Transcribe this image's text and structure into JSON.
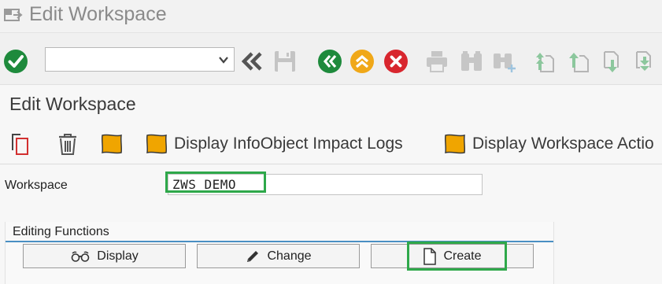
{
  "window": {
    "title": "Edit Workspace"
  },
  "toolbar": {
    "command_field": {
      "value": "",
      "placeholder": ""
    },
    "icons": [
      "enter-icon",
      "dropdown-icon",
      "back-nav-icon",
      "save-icon",
      "back-icon",
      "exit-icon",
      "cancel-icon",
      "print-icon",
      "find-icon",
      "find-next-icon",
      "first-page-icon",
      "previous-page-icon",
      "next-page-icon",
      "last-page-icon"
    ]
  },
  "screen": {
    "title": "Edit Workspace"
  },
  "app_toolbar": {
    "impact_logs_label": "Display InfoObject Impact Logs",
    "workspace_actions_label": "Display Workspace Actio"
  },
  "workspace": {
    "label": "Workspace",
    "value": "ZWS_DEMO"
  },
  "editing": {
    "group_title": "Editing Functions",
    "display_label": "Display",
    "change_label": "Change",
    "create_label": "Create"
  },
  "colors": {
    "enter_green": "#1e8a3c",
    "back_green": "#1e8a3c",
    "exit_orange": "#f0a818",
    "cancel_red": "#d8262e",
    "highlight_green": "#2ea84a",
    "group_line_blue": "#4a8fc3",
    "object_orange": "#f0a500"
  }
}
